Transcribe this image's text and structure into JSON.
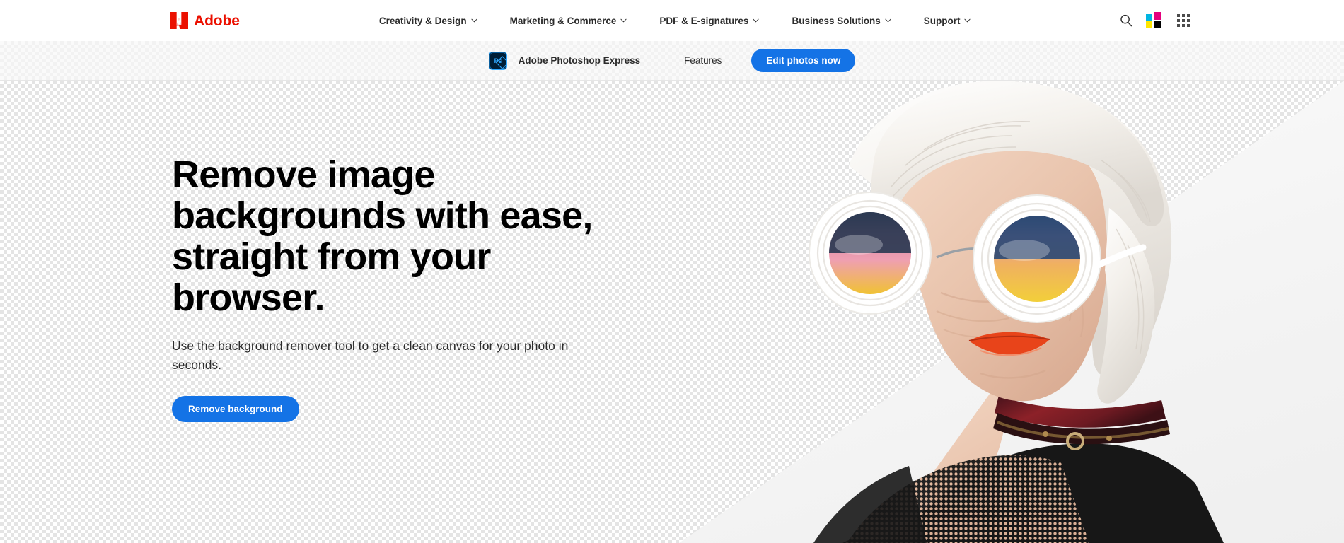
{
  "global_nav": {
    "brand": {
      "name": "Adobe",
      "logo_icon": "adobe-triangle-logo",
      "color": "#eb1000"
    },
    "links": [
      {
        "label": "Creativity & Design",
        "has_dropdown": true
      },
      {
        "label": "Marketing & Commerce",
        "has_dropdown": true
      },
      {
        "label": "PDF & E-signatures",
        "has_dropdown": true
      },
      {
        "label": "Business Solutions",
        "has_dropdown": true
      },
      {
        "label": "Support",
        "has_dropdown": true
      }
    ],
    "actions": [
      {
        "icon": "search-icon",
        "label": "Search"
      },
      {
        "icon": "creative-cloud-cmyk-logo",
        "label": "Adobe Creative Cloud"
      },
      {
        "icon": "app-grid-icon",
        "label": "All apps"
      }
    ]
  },
  "product_nav": {
    "product_icon": "photoshop-express-ps-icon",
    "product_name": "Adobe Photoshop Express",
    "links": [
      {
        "label": "Features"
      }
    ],
    "cta": {
      "label": "Edit photos now",
      "color": "#1473e6"
    }
  },
  "hero": {
    "headline": "Remove image backgrounds with ease, straight from your browser.",
    "subhead": "Use the background remover tool to get a clean canvas for your photo in seconds.",
    "cta": {
      "label": "Remove background",
      "color": "#1473e6"
    },
    "background": {
      "pattern": "transparency-checkerboard",
      "checker_light": "#ffffff",
      "checker_dark": "#e4e4e4"
    },
    "image": {
      "name": "elderly-woman-portrait",
      "description": "Elderly woman with white hair wearing large round white-framed sunglasses with pink-and-yellow gradient lenses, orange-red lipstick, a dark red leather choker with a metal ring, and a black top with fishnet mesh shoulder",
      "colors": {
        "hair": "#f2efe9",
        "skin": "#e9c4ad",
        "lips": "#e8441a",
        "frames": "#ffffff",
        "lens_top": "#2b3a52",
        "lens_mid": "#e8a0b4",
        "lens_bottom": "#f2c832",
        "choker": "#7c1f27",
        "top": "#171717"
      }
    }
  }
}
